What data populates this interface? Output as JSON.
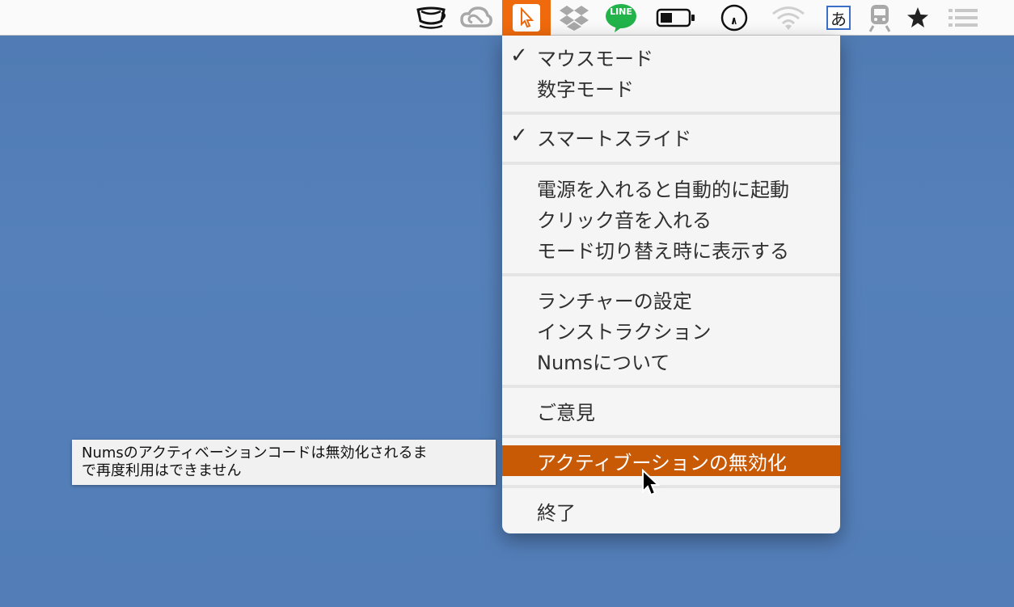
{
  "menubar": {
    "icons": [
      "coffee-cup-icon",
      "creative-cloud-icon",
      "nums-cursor-icon",
      "dropbox-icon",
      "line-icon",
      "battery-icon",
      "clock-icon",
      "wifi-icon",
      "input-method-icon",
      "train-icon",
      "star-icon",
      "list-icon"
    ],
    "line_label": "LINE",
    "input_method_label": "あ",
    "accent_color": "#ee6a0c"
  },
  "menu": {
    "mouse_mode": "マウスモード",
    "number_mode": "数字モード",
    "smart_slide": "スマートスライド",
    "launch_at_login": "電源を入れると自動的に起動",
    "click_sound": "クリック音を入れる",
    "show_on_switch": "モード切り替え時に表示する",
    "launcher_settings": "ランチャーの設定",
    "instructions": "インストラクション",
    "about": "Numsについて",
    "feedback": "ご意見",
    "deactivate": "アクティブーションの無効化",
    "quit": "終了",
    "checkmark": "✓",
    "highlight_color": "#c85a06"
  },
  "tooltip": {
    "line1": "Numsのアクティベーションコードは無効化されるま",
    "line2": "で再度利用はできません"
  }
}
